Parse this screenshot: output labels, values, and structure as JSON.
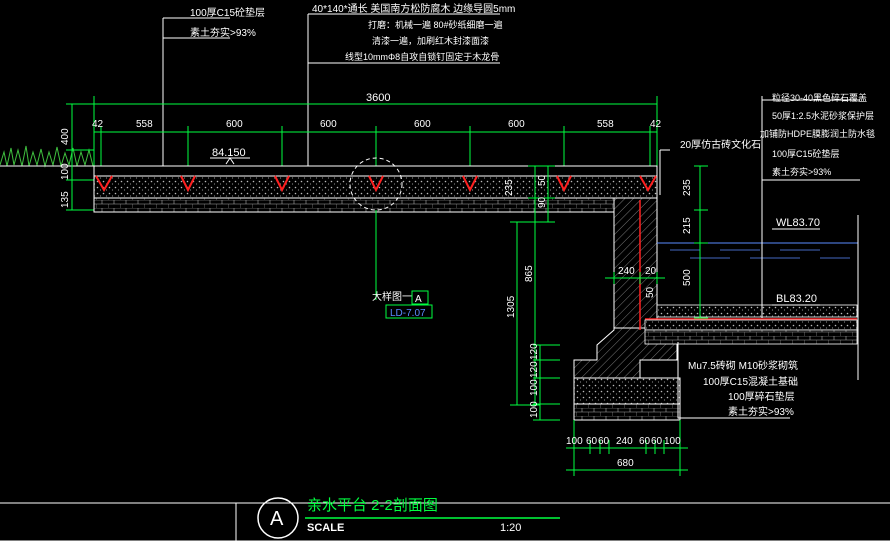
{
  "callouts_top_left": [
    "100厚C15砼垫层",
    "素土夯实>93%"
  ],
  "callouts_top_center": [
    "40*140*通长  美国南方松防腐木  边缘导圆5mm",
    "打磨：机械一遍  80#砂纸细磨一遍",
    "清漆一遍，加刷红木封漆面漆",
    "线型10mmΦ8自攻自锁钉固定于木龙骨"
  ],
  "callouts_right": [
    "粒径30-40黑色碎石覆盖",
    "50厚1:2.5水泥砂浆保护层",
    "加铺防HDPE膜膨润土防水毯",
    "100厚C15砼垫层",
    "素土夯实>93%"
  ],
  "callout_right_cap": "20厚仿古砖文化石",
  "callouts_foundation": [
    "Mu7.5砖砌 M10砂浆砌筑",
    "100厚C15混凝土基础",
    "100厚碎石垫层",
    "素土夯实>93%"
  ],
  "dims_top_total": "3600",
  "dims_top_segments": [
    "42",
    "558",
    "600",
    "600",
    "600",
    "600",
    "558",
    "42"
  ],
  "dims_left": [
    "400",
    "100",
    "135"
  ],
  "elevation_deck": "84.150",
  "water_level": "WL83.70",
  "bottom_level": "BL83.20",
  "dims_right_col": [
    "235",
    "215",
    "500"
  ],
  "dims_wall": [
    "240",
    "20",
    "50"
  ],
  "dims_mid_v": [
    "235",
    "50",
    "90",
    "865",
    "1305"
  ],
  "dims_stack_v": [
    "120",
    "120",
    "100",
    "100"
  ],
  "dims_base": [
    "100",
    "60",
    "60",
    "240",
    "60",
    "60",
    "100"
  ],
  "dims_base_total": "680",
  "detail_ref_label": "大样图一",
  "detail_ref_letter": "A",
  "detail_ref_code": "LD-7.07",
  "title_letter": "A",
  "title": "亲水平台  2-2剖面图",
  "scale_label": "SCALE",
  "scale_value": "1:20",
  "colors": {
    "background": "#000000",
    "line": "#ffffff",
    "dim": "#00ff40",
    "accent": "#ff2020",
    "water": "#5a8cff"
  }
}
